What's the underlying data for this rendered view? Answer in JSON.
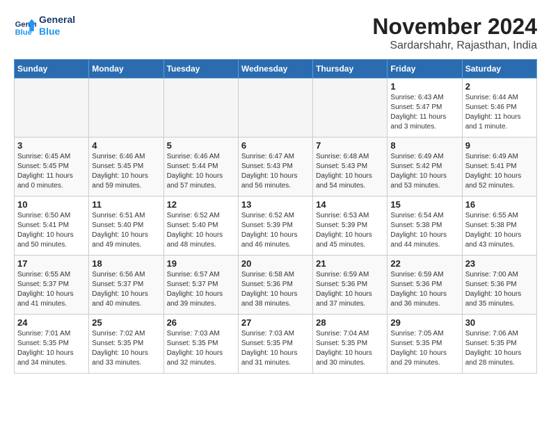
{
  "header": {
    "logo_line1": "General",
    "logo_line2": "Blue",
    "month": "November 2024",
    "location": "Sardarshahr, Rajasthan, India"
  },
  "weekdays": [
    "Sunday",
    "Monday",
    "Tuesday",
    "Wednesday",
    "Thursday",
    "Friday",
    "Saturday"
  ],
  "weeks": [
    [
      {
        "day": "",
        "info": ""
      },
      {
        "day": "",
        "info": ""
      },
      {
        "day": "",
        "info": ""
      },
      {
        "day": "",
        "info": ""
      },
      {
        "day": "",
        "info": ""
      },
      {
        "day": "1",
        "info": "Sunrise: 6:43 AM\nSunset: 5:47 PM\nDaylight: 11 hours\nand 3 minutes."
      },
      {
        "day": "2",
        "info": "Sunrise: 6:44 AM\nSunset: 5:46 PM\nDaylight: 11 hours\nand 1 minute."
      }
    ],
    [
      {
        "day": "3",
        "info": "Sunrise: 6:45 AM\nSunset: 5:45 PM\nDaylight: 11 hours\nand 0 minutes."
      },
      {
        "day": "4",
        "info": "Sunrise: 6:46 AM\nSunset: 5:45 PM\nDaylight: 10 hours\nand 59 minutes."
      },
      {
        "day": "5",
        "info": "Sunrise: 6:46 AM\nSunset: 5:44 PM\nDaylight: 10 hours\nand 57 minutes."
      },
      {
        "day": "6",
        "info": "Sunrise: 6:47 AM\nSunset: 5:43 PM\nDaylight: 10 hours\nand 56 minutes."
      },
      {
        "day": "7",
        "info": "Sunrise: 6:48 AM\nSunset: 5:43 PM\nDaylight: 10 hours\nand 54 minutes."
      },
      {
        "day": "8",
        "info": "Sunrise: 6:49 AM\nSunset: 5:42 PM\nDaylight: 10 hours\nand 53 minutes."
      },
      {
        "day": "9",
        "info": "Sunrise: 6:49 AM\nSunset: 5:41 PM\nDaylight: 10 hours\nand 52 minutes."
      }
    ],
    [
      {
        "day": "10",
        "info": "Sunrise: 6:50 AM\nSunset: 5:41 PM\nDaylight: 10 hours\nand 50 minutes."
      },
      {
        "day": "11",
        "info": "Sunrise: 6:51 AM\nSunset: 5:40 PM\nDaylight: 10 hours\nand 49 minutes."
      },
      {
        "day": "12",
        "info": "Sunrise: 6:52 AM\nSunset: 5:40 PM\nDaylight: 10 hours\nand 48 minutes."
      },
      {
        "day": "13",
        "info": "Sunrise: 6:52 AM\nSunset: 5:39 PM\nDaylight: 10 hours\nand 46 minutes."
      },
      {
        "day": "14",
        "info": "Sunrise: 6:53 AM\nSunset: 5:39 PM\nDaylight: 10 hours\nand 45 minutes."
      },
      {
        "day": "15",
        "info": "Sunrise: 6:54 AM\nSunset: 5:38 PM\nDaylight: 10 hours\nand 44 minutes."
      },
      {
        "day": "16",
        "info": "Sunrise: 6:55 AM\nSunset: 5:38 PM\nDaylight: 10 hours\nand 43 minutes."
      }
    ],
    [
      {
        "day": "17",
        "info": "Sunrise: 6:55 AM\nSunset: 5:37 PM\nDaylight: 10 hours\nand 41 minutes."
      },
      {
        "day": "18",
        "info": "Sunrise: 6:56 AM\nSunset: 5:37 PM\nDaylight: 10 hours\nand 40 minutes."
      },
      {
        "day": "19",
        "info": "Sunrise: 6:57 AM\nSunset: 5:37 PM\nDaylight: 10 hours\nand 39 minutes."
      },
      {
        "day": "20",
        "info": "Sunrise: 6:58 AM\nSunset: 5:36 PM\nDaylight: 10 hours\nand 38 minutes."
      },
      {
        "day": "21",
        "info": "Sunrise: 6:59 AM\nSunset: 5:36 PM\nDaylight: 10 hours\nand 37 minutes."
      },
      {
        "day": "22",
        "info": "Sunrise: 6:59 AM\nSunset: 5:36 PM\nDaylight: 10 hours\nand 36 minutes."
      },
      {
        "day": "23",
        "info": "Sunrise: 7:00 AM\nSunset: 5:36 PM\nDaylight: 10 hours\nand 35 minutes."
      }
    ],
    [
      {
        "day": "24",
        "info": "Sunrise: 7:01 AM\nSunset: 5:35 PM\nDaylight: 10 hours\nand 34 minutes."
      },
      {
        "day": "25",
        "info": "Sunrise: 7:02 AM\nSunset: 5:35 PM\nDaylight: 10 hours\nand 33 minutes."
      },
      {
        "day": "26",
        "info": "Sunrise: 7:03 AM\nSunset: 5:35 PM\nDaylight: 10 hours\nand 32 minutes."
      },
      {
        "day": "27",
        "info": "Sunrise: 7:03 AM\nSunset: 5:35 PM\nDaylight: 10 hours\nand 31 minutes."
      },
      {
        "day": "28",
        "info": "Sunrise: 7:04 AM\nSunset: 5:35 PM\nDaylight: 10 hours\nand 30 minutes."
      },
      {
        "day": "29",
        "info": "Sunrise: 7:05 AM\nSunset: 5:35 PM\nDaylight: 10 hours\nand 29 minutes."
      },
      {
        "day": "30",
        "info": "Sunrise: 7:06 AM\nSunset: 5:35 PM\nDaylight: 10 hours\nand 28 minutes."
      }
    ]
  ]
}
